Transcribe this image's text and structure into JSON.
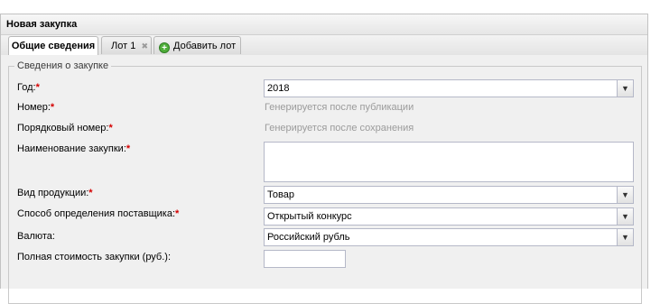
{
  "panel": {
    "title": "Новая закупка"
  },
  "tabs": [
    {
      "label": "Общие сведения"
    },
    {
      "label": "Лот 1"
    },
    {
      "label": "Добавить лот"
    }
  ],
  "fieldset": {
    "legend": "Сведения о закупке"
  },
  "fields": {
    "year": {
      "label": "Год:",
      "value": "2018"
    },
    "number": {
      "label": "Номер:",
      "hint": "Генерируется после публикации"
    },
    "seq_number": {
      "label": "Порядковый номер:",
      "hint": "Генерируется после сохранения"
    },
    "name": {
      "label": "Наименование закупки:",
      "value": ""
    },
    "product_type": {
      "label": "Вид продукции:",
      "value": "Товар"
    },
    "method": {
      "label": "Способ определения поставщика:",
      "value": "Открытый конкурс"
    },
    "currency": {
      "label": "Валюта:",
      "value": "Российский рубль"
    },
    "total_cost": {
      "label": "Полная стоимость закупки (руб.):",
      "value": ""
    }
  },
  "required_mark": "*",
  "icons": {
    "dropdown": "chevron-down-icon",
    "close": "close-icon",
    "add": "add-icon"
  }
}
